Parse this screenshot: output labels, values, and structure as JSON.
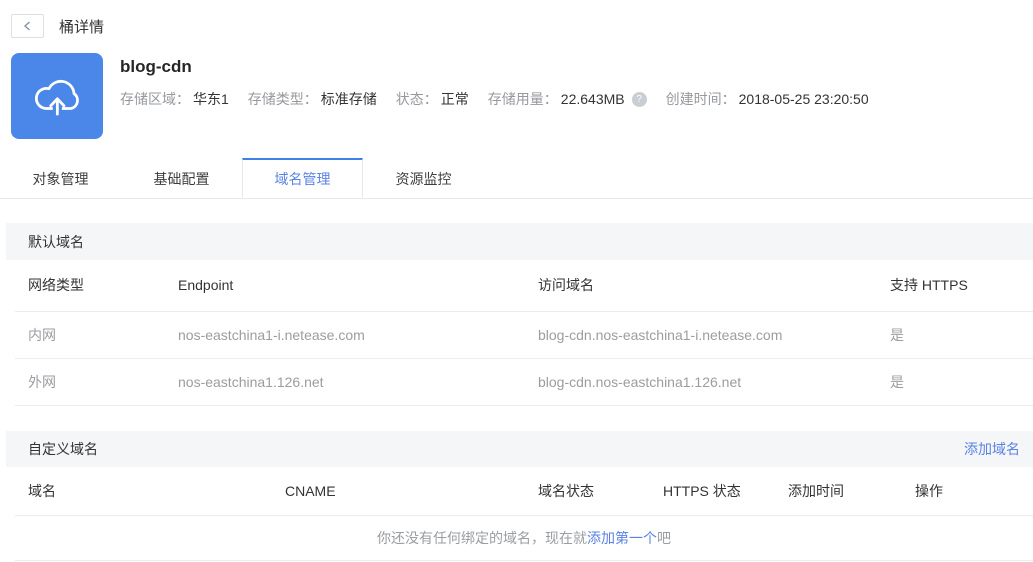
{
  "page": {
    "back_title": "桶详情"
  },
  "bucket": {
    "name": "blog-cdn",
    "meta": [
      {
        "label": "存储区域：",
        "value": "华东1"
      },
      {
        "label": "存储类型：",
        "value": "标准存储"
      },
      {
        "label": "状态：",
        "value": "正常"
      },
      {
        "label": "存储用量：",
        "value": "22.643MB"
      },
      {
        "label": "创建时间：",
        "value": "2018-05-25 23:20:50"
      }
    ],
    "usage_help_glyph": "?"
  },
  "tabs": [
    {
      "label": "对象管理",
      "active": false
    },
    {
      "label": "基础配置",
      "active": false
    },
    {
      "label": "域名管理",
      "active": true
    },
    {
      "label": "资源监控",
      "active": false
    }
  ],
  "default_domains": {
    "section_title": "默认域名",
    "columns": [
      "网络类型",
      "Endpoint",
      "访问域名",
      "支持 HTTPS"
    ],
    "rows": [
      [
        "内网",
        "nos-eastchina1-i.netease.com",
        "blog-cdn.nos-eastchina1-i.netease.com",
        "是"
      ],
      [
        "外网",
        "nos-eastchina1.126.net",
        "blog-cdn.nos-eastchina1.126.net",
        "是"
      ]
    ]
  },
  "custom_domains": {
    "section_title": "自定义域名",
    "add_link": "添加域名",
    "columns": [
      "域名",
      "CNAME",
      "域名状态",
      "HTTPS 状态",
      "添加时间",
      "操作"
    ],
    "empty": {
      "prefix": "你还没有任何绑定的域名，现在就",
      "link": "添加第一个",
      "suffix": "吧"
    }
  },
  "colors": {
    "accent": "#5a82e6",
    "tab_active_border": "#4080e8",
    "icon_bg": "#4a87e8",
    "section_bg": "#f5f6f7"
  }
}
